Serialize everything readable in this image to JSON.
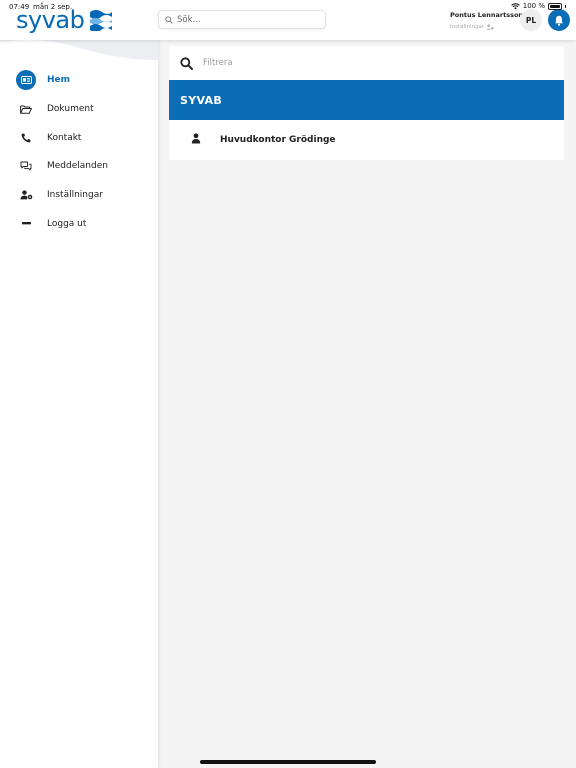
{
  "status_bar": {
    "time": "07:49",
    "date": "mån 2 sep.",
    "battery": "100 %"
  },
  "header": {
    "logo_text": "syvab",
    "search_placeholder": "Sök...",
    "user_name": "Pontus Lennartsson",
    "settings_label": "Inställningar",
    "avatar_initials": "PL",
    "brand_color": "#0b6db5"
  },
  "sidebar": {
    "items": [
      {
        "label": "Hem",
        "icon": "home-card-icon",
        "active": true
      },
      {
        "label": "Dokument",
        "icon": "folder-open-icon",
        "active": false
      },
      {
        "label": "Kontakt",
        "icon": "phone-icon",
        "active": false
      },
      {
        "label": "Meddelanden",
        "icon": "chat-bubbles-icon",
        "active": false
      },
      {
        "label": "Inställningar",
        "icon": "user-cog-icon",
        "active": false
      },
      {
        "label": "Logga ut",
        "icon": "minus-icon",
        "active": false
      }
    ]
  },
  "main": {
    "filter_placeholder": "Filtrera",
    "group_title": "SYVAB",
    "list_items": [
      {
        "label": "Huvudkontor Grödinge",
        "icon": "person-icon"
      }
    ]
  }
}
